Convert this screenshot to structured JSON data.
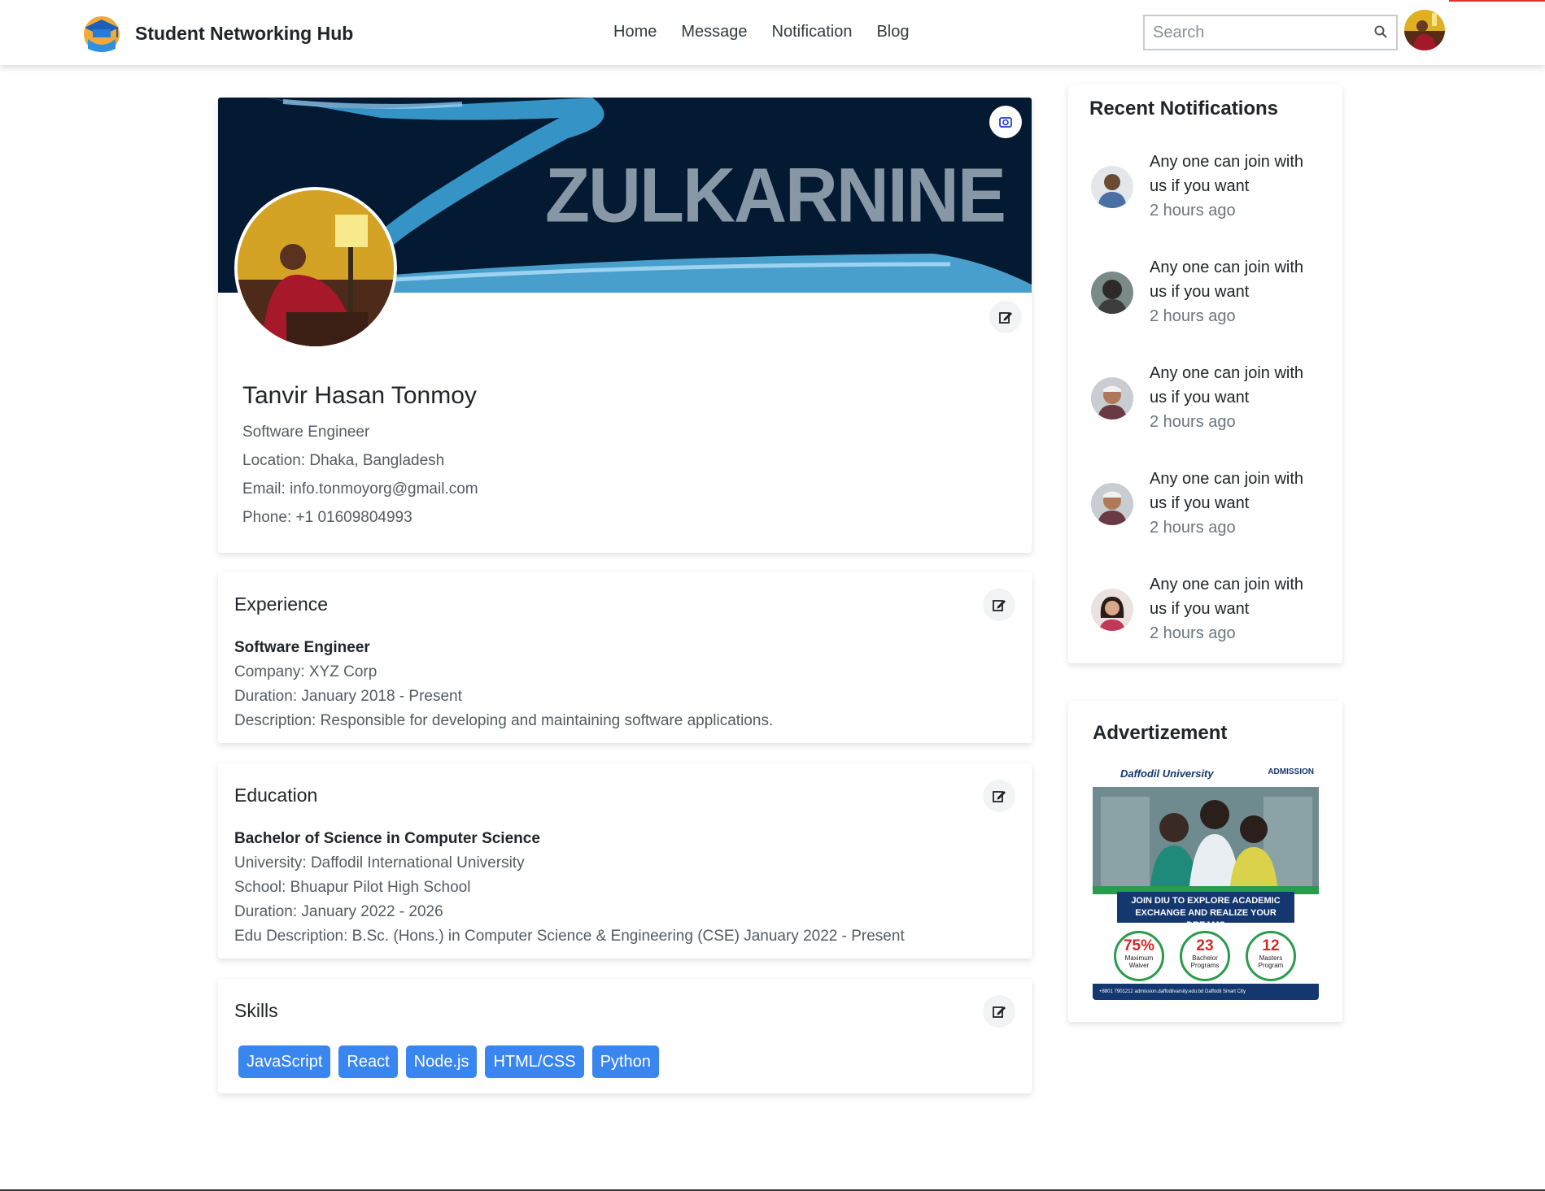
{
  "navbar": {
    "brand": "Student Networking Hub",
    "links": [
      "Home",
      "Message",
      "Notification",
      "Blog"
    ],
    "search_placeholder": "Search"
  },
  "profile": {
    "cover_text": "ZULKARNINE",
    "name": "Tanvir Hasan Tonmoy",
    "title": "Software Engineer",
    "location": "Location: Dhaka, Bangladesh",
    "email": "Email: info.tonmoyorg@gmail.com",
    "phone": "Phone: +1 01609804993"
  },
  "experience": {
    "heading": "Experience",
    "role": "Software Engineer",
    "company": "Company: XYZ Corp",
    "duration": "Duration: January 2018 - Present",
    "description": "Description: Responsible for developing and maintaining software applications."
  },
  "education": {
    "heading": "Education",
    "degree": "Bachelor of Science in Computer Science",
    "university": "University: Daffodil International University",
    "school": "School: Bhuapur Pilot High School",
    "duration": "Duration: January 2022 - 2026",
    "description": "Edu Description: B.Sc. (Hons.) in Computer Science & Engineering (CSE) January 2022 - Present"
  },
  "skills": {
    "heading": "Skills",
    "items": [
      "JavaScript",
      "React",
      "Node.js",
      "HTML/CSS",
      "Python"
    ]
  },
  "notifications": {
    "heading": "Recent Notifications",
    "items": [
      {
        "text": "Any one can join with us if you want",
        "time": "2 hours ago"
      },
      {
        "text": "Any one can join with us if you want",
        "time": "2 hours ago"
      },
      {
        "text": "Any one can join with us if you want",
        "time": "2 hours ago"
      },
      {
        "text": "Any one can join with us if you want",
        "time": "2 hours ago"
      },
      {
        "text": "Any one can join with us if you want",
        "time": "2 hours ago"
      }
    ]
  },
  "advertisement": {
    "heading": "Advertizement",
    "logo": "Daffodil University",
    "badge": "ADMISSION",
    "tagline": "JOIN DIU TO EXPLORE ACADEMIC EXCHANGE AND REALIZE YOUR DREAMS",
    "stats": [
      {
        "value": "75%",
        "label": "Maximum Waiver"
      },
      {
        "value": "23",
        "label": "Bachelor Programs"
      },
      {
        "value": "12",
        "label": "Masters Program"
      }
    ],
    "footer": "+8801 7901212   admission.daffodilvarsity.edu.bd   Daffodil Smart City"
  },
  "colors": {
    "accent": "#3a86f0",
    "cover_bg": "#041a33",
    "ad_green": "#2b9b4c",
    "ad_navy": "#13376e"
  }
}
